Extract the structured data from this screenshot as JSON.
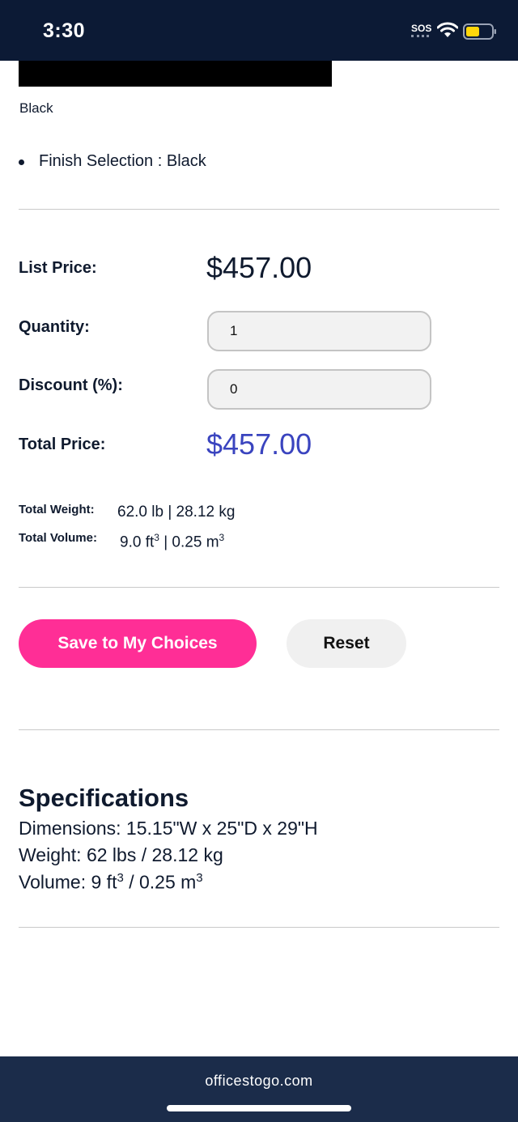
{
  "status_bar": {
    "time": "3:30",
    "sos": "SOS"
  },
  "product": {
    "swatch_label": "Black",
    "finish_selection": "Finish Selection : Black"
  },
  "pricing": {
    "list_price_label": "List Price:",
    "list_price": "$457.00",
    "quantity_label": "Quantity:",
    "quantity_value": "1",
    "discount_label": "Discount (%):",
    "discount_value": "0",
    "total_price_label": "Total Price:",
    "total_price": "$457.00"
  },
  "totals": {
    "weight_label": "Total Weight:",
    "weight_value": "62.0 lb | 28.12 kg",
    "volume_label": "Total Volume:",
    "volume_ft": "9.0 ft",
    "volume_sep": " | 0.25 m",
    "cube": "3"
  },
  "actions": {
    "save_label": "Save to My Choices",
    "reset_label": "Reset"
  },
  "specifications": {
    "title": "Specifications",
    "dimensions": "Dimensions: 15.15\"W x 25\"D x 29\"H",
    "weight": "Weight: 62 lbs / 28.12 kg",
    "volume_a": "Volume: 9 ft",
    "volume_b": " / 0.25 m",
    "cube": "3"
  },
  "browser": {
    "url": "officestogo.com"
  },
  "colors": {
    "header_bg": "#0c1a35",
    "accent_pink": "#ff2e96",
    "total_price_blue": "#3a44bf",
    "footer_bg": "#1b2c4a",
    "battery_yellow": "#ffd60a"
  }
}
